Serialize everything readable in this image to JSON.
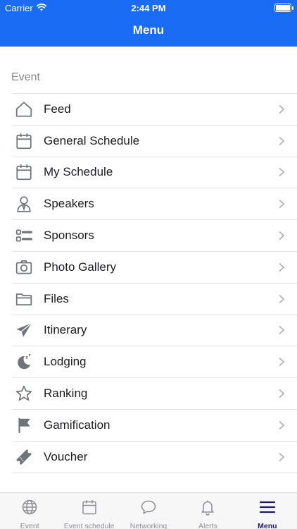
{
  "status_bar": {
    "carrier": "Carrier",
    "time": "2:44 PM"
  },
  "header": {
    "title": "Menu"
  },
  "section": {
    "title": "Event"
  },
  "menu_items": [
    {
      "label": "Feed",
      "icon": "home-icon"
    },
    {
      "label": "General Schedule",
      "icon": "calendar-icon"
    },
    {
      "label": "My Schedule",
      "icon": "calendar-icon"
    },
    {
      "label": "Speakers",
      "icon": "speaker-person-icon"
    },
    {
      "label": "Sponsors",
      "icon": "sponsors-list-icon"
    },
    {
      "label": "Photo Gallery",
      "icon": "camera-icon"
    },
    {
      "label": "Files",
      "icon": "folder-icon"
    },
    {
      "label": "Itinerary",
      "icon": "paper-plane-icon"
    },
    {
      "label": "Lodging",
      "icon": "moon-sleep-icon"
    },
    {
      "label": "Ranking",
      "icon": "star-icon"
    },
    {
      "label": "Gamification",
      "icon": "flag-icon"
    },
    {
      "label": "Voucher",
      "icon": "ticket-icon"
    }
  ],
  "tab_bar": [
    {
      "label": "Event",
      "icon": "globe-icon",
      "active": false
    },
    {
      "label": "Event schedule",
      "icon": "calendar-icon",
      "active": false
    },
    {
      "label": "Networking",
      "icon": "chat-bubble-icon",
      "active": false
    },
    {
      "label": "Alerts",
      "icon": "bell-icon",
      "active": false
    },
    {
      "label": "Menu",
      "icon": "hamburger-menu-icon",
      "active": true
    }
  ],
  "colors": {
    "header": "#1a6cf5",
    "active_tab": "#1d1a6e",
    "icon_gray": "#6f7479",
    "inactive_tab": "#8e8e93"
  }
}
